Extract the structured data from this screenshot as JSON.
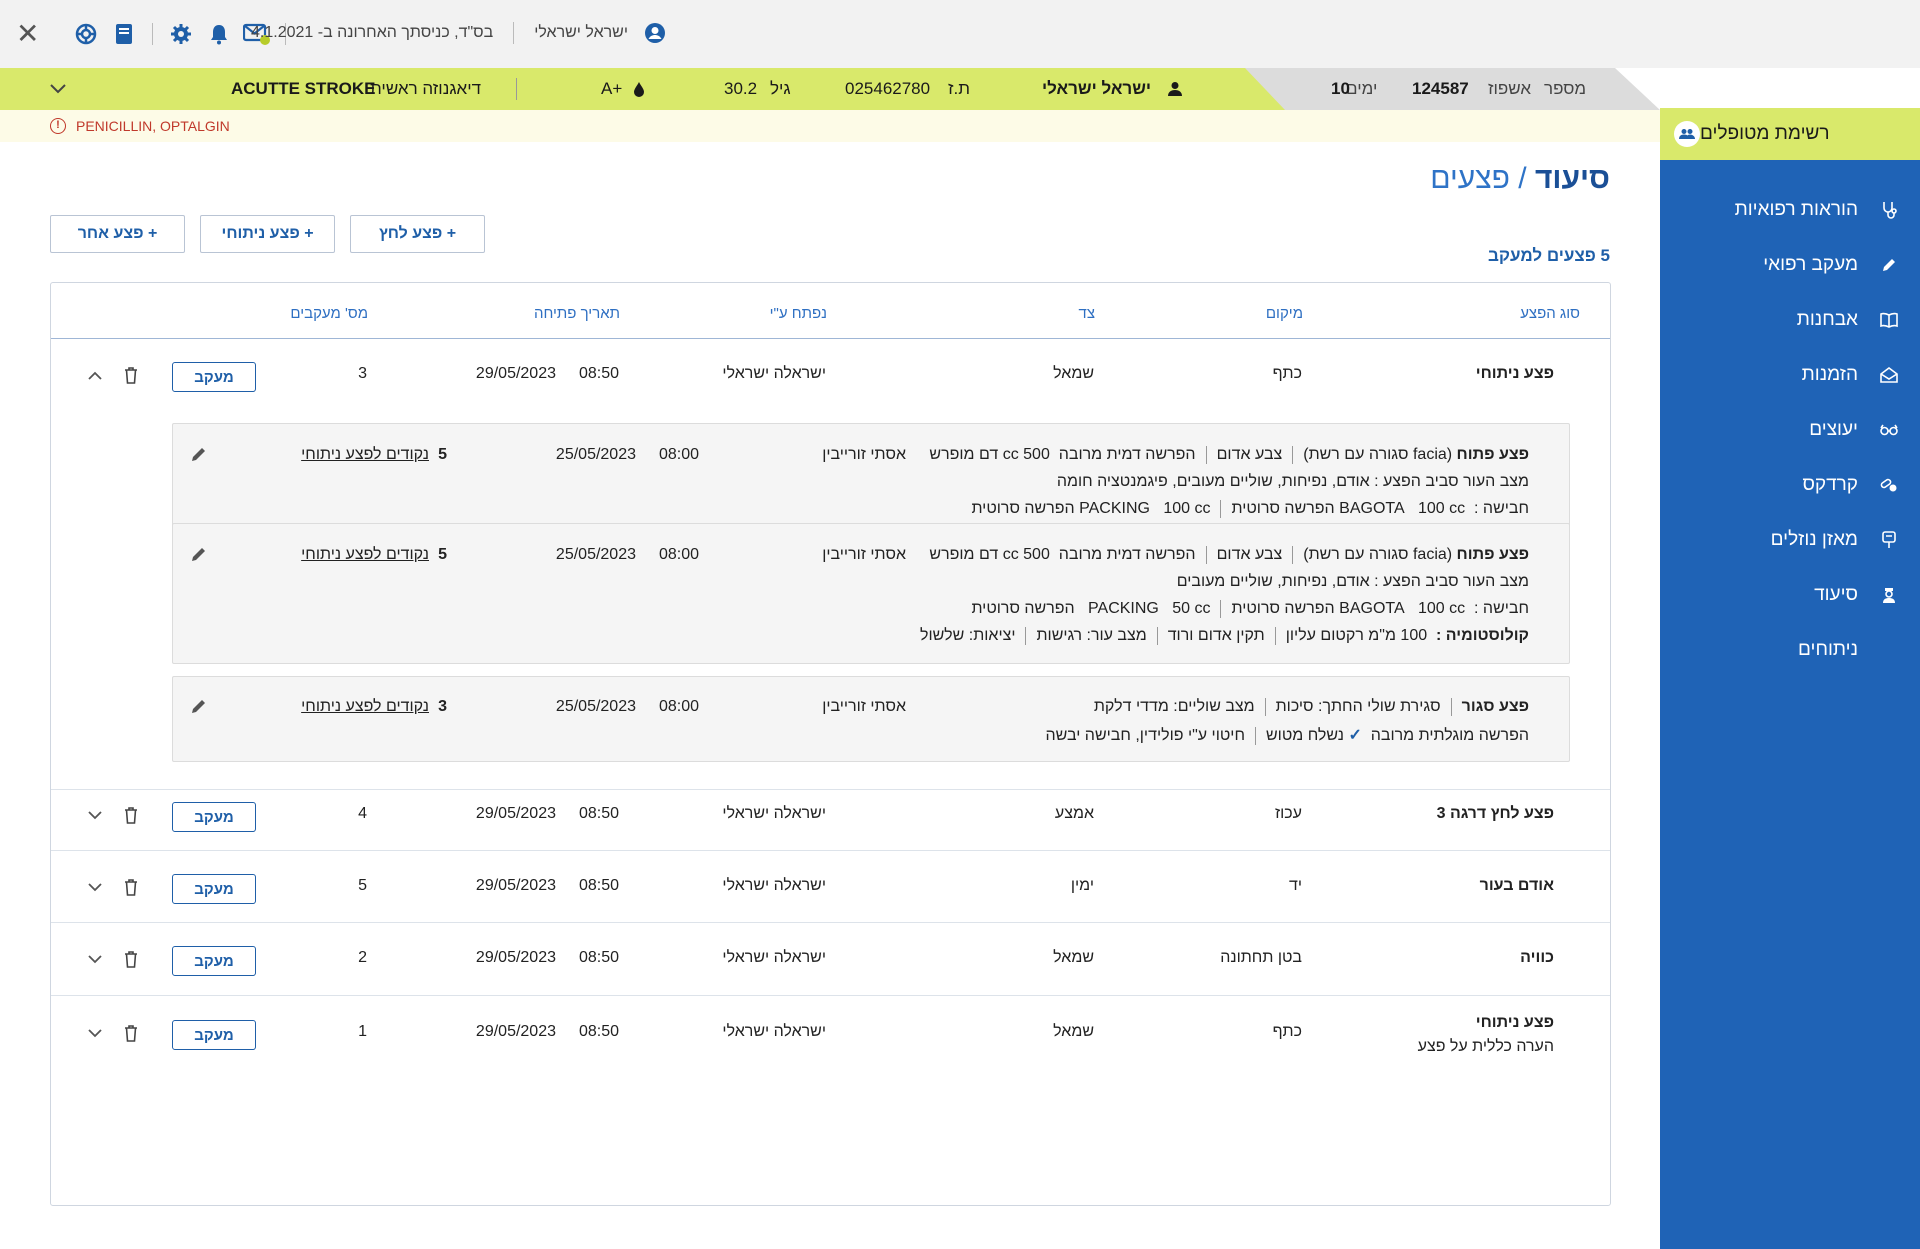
{
  "top": {
    "user": "ישראל ישראלי",
    "last_entry": "בס\"ד, כניסתך האחרונה ב- 4.1.2021"
  },
  "strip": {
    "admission_label": "מספר",
    "admission_type": "אשפוז",
    "admission_number": "124587",
    "days_label": "ימים",
    "days": "10",
    "patient_name": "ישראל ישראלי",
    "id_label": "ת.ז",
    "id_number": "025462780",
    "age_label": "גיל",
    "age": "30.2",
    "blood_type": "A+",
    "diagnosis_label": "דיאגנוזה ראשית",
    "diagnosis": "ACUTTE STROKE"
  },
  "allergies": "PENICILLIN, OPTALGIN",
  "sidebar": {
    "patients_label": "רשימת מטופלים",
    "items": [
      {
        "label": "הוראות רפואיות",
        "icon": "stethoscope-icon"
      },
      {
        "label": "מעקב רפואי",
        "icon": "pencil-icon"
      },
      {
        "label": "אבחנות",
        "icon": "book-icon"
      },
      {
        "label": "הזמנות",
        "icon": "envelope-open-icon"
      },
      {
        "label": "יעוצים",
        "icon": "glasses-icon"
      },
      {
        "label": "קרדקס",
        "icon": "pills-icon"
      },
      {
        "label": "מאזן נוזלים",
        "icon": "drip-icon"
      },
      {
        "label": "סיעוד",
        "icon": "nurse-icon"
      },
      {
        "label": "ניתוחים",
        "icon": ""
      }
    ]
  },
  "page": {
    "title_main": "סיעוד",
    "title_sep": "/",
    "title_sub": "פצעים",
    "count_text": "5 פצעים למעקב"
  },
  "buttons": {
    "pressure": "+ פצע לחץ",
    "surgical": "+ פצע ניתוחי",
    "other": "+ פצע אחר"
  },
  "columns": {
    "type": "סוג הפצע",
    "location": "מיקום",
    "side": "צד",
    "opened_by": "נפתח ע\"י",
    "open_date": "תאריך פתיחה",
    "trackings": "מס' מעקבים"
  },
  "track_label": "מעקב",
  "rows": [
    {
      "type": "פצע ניתוחי",
      "location": "כתף",
      "side": "שמאל",
      "opened_by": "ישראלה ישראלי",
      "date": "29/05/2023",
      "time": "08:50",
      "count": "3"
    },
    {
      "type": "פצע לחץ דרגה 3",
      "location": "עכוז",
      "side": "אמצע",
      "opened_by": "ישראלה ישראלי",
      "date": "29/05/2023",
      "time": "08:50",
      "count": "4"
    },
    {
      "type": "אודם בעור",
      "location": "יד",
      "side": "ימין",
      "opened_by": "ישראלה ישראלי",
      "date": "29/05/2023",
      "time": "08:50",
      "count": "5"
    },
    {
      "type": "כוויה",
      "location": "בטן תחתונה",
      "side": "שמאל",
      "opened_by": "ישראלה ישראלי",
      "date": "29/05/2023",
      "time": "08:50",
      "count": "2"
    },
    {
      "type": "פצע ניתוחי",
      "note": "הערה כללית על פצע",
      "location": "כתף",
      "side": "שמאל",
      "opened_by": "ישראלה ישראלי",
      "date": "29/05/2023",
      "time": "08:50",
      "count": "1"
    }
  ],
  "subs": [
    {
      "by": "אסתי זורייבין",
      "date": "25/05/2023",
      "time": "08:00",
      "points": "5",
      "points_label": "נקודים לפצע ניתוחי",
      "l1": {
        "head": "פצע פתוח",
        "a": "(facia סגורה עם רשת)",
        "b": "צבע אדום",
        "c": "הפרשה דמית מרובה",
        "d": "500 cc",
        "e": "דם מופרש"
      },
      "l2": "מצב העור סביב הפצע : אודם, נפיחות, שוליים מעובים, פיגמנטציה חומה",
      "l3": {
        "head": "חבישה :",
        "a": "BAGOTA",
        "b": "100 cc",
        "c": "הפרשה סרוטית",
        "d": "PACKING",
        "e": "100 cc",
        "f": "הפרשה סרוטית"
      }
    },
    {
      "by": "אסתי זורייבין",
      "date": "25/05/2023",
      "time": "08:00",
      "points": "5",
      "points_label": "נקודים לפצע ניתוחי",
      "l1": {
        "head": "פצע פתוח",
        "a": "(facia סגורה עם רשת)",
        "b": "צבע אדום",
        "c": "הפרשה דמית מרובה",
        "d": "500 cc",
        "e": "דם מופרש"
      },
      "l2": "מצב העור סביב הפצע : אודם, נפיחות, שוליים מעובים",
      "l3": {
        "head": "חבישה :",
        "a": "BAGOTA",
        "b": "100 cc",
        "c": "הפרשה סרוטית",
        "d": "PACKING",
        "e": "50 cc",
        "f": "הפרשה סרוטית"
      },
      "l4": {
        "head": "קולוסטומיה :",
        "a": "100 מ\"מ רקטום עליון",
        "b": "תקין אדום ורוד",
        "c": "מצב עור: רגישות",
        "d": "יציאות: שלשול"
      }
    },
    {
      "by": "אסתי זורייבין",
      "date": "25/05/2023",
      "time": "08:00",
      "points": "3",
      "points_label": "נקודים לפצע ניתוחי",
      "l1": {
        "head": "פצע סגור",
        "a": "סגירת שולי החתך: סיכות",
        "b": "מצב שוליים: מדדי דלקת"
      },
      "l2": {
        "a": "הפרשה מוגלתית מרובה",
        "b": "נשלח מטוש",
        "c": "חיטוי ע\"י פולידין, חבישה יבשה"
      }
    }
  ]
}
